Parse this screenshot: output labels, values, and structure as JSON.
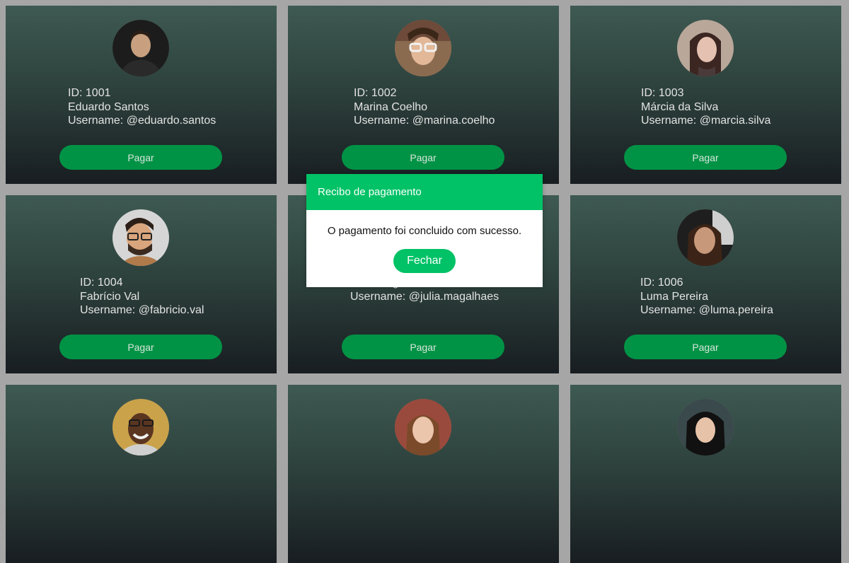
{
  "colors": {
    "page_background": "#a6a6a6",
    "card_gradient_top": "#3e5a52",
    "card_gradient_bottom": "#181d21",
    "pay_button": "#009345",
    "modal_accent": "#01c266"
  },
  "users": [
    {
      "id_text": "ID: 1001",
      "name": "Eduardo Santos",
      "username_text": "Username: @eduardo.santos",
      "pay_label": "Pagar",
      "avatar": "avatar-photo-eduardo"
    },
    {
      "id_text": "ID: 1002",
      "name": "Marina Coelho",
      "username_text": "Username: @marina.coelho",
      "pay_label": "Pagar",
      "avatar": "avatar-photo-marina"
    },
    {
      "id_text": "ID: 1003",
      "name": "Márcia da Silva",
      "username_text": "Username: @marcia.silva",
      "pay_label": "Pagar",
      "avatar": "avatar-photo-marcia"
    },
    {
      "id_text": "ID: 1004",
      "name": "Fabrício Val",
      "username_text": "Username: @fabricio.val",
      "pay_label": "Pagar",
      "avatar": "avatar-photo-fabricio"
    },
    {
      "id_text": "",
      "name": "Júlia Magalhães",
      "username_text": "Username: @julia.magalhaes",
      "pay_label": "Pagar",
      "avatar": "avatar-photo-julia"
    },
    {
      "id_text": "ID: 1006",
      "name": "Luma Pereira",
      "username_text": "Username: @luma.pereira",
      "pay_label": "Pagar",
      "avatar": "avatar-photo-luma"
    },
    {
      "avatar": "avatar-photo-7"
    },
    {
      "avatar": "avatar-photo-8"
    },
    {
      "avatar": "avatar-photo-9"
    }
  ],
  "modal": {
    "title": "Recibo de pagamento",
    "message": "O pagamento foi concluido com sucesso.",
    "close_label": "Fechar"
  }
}
